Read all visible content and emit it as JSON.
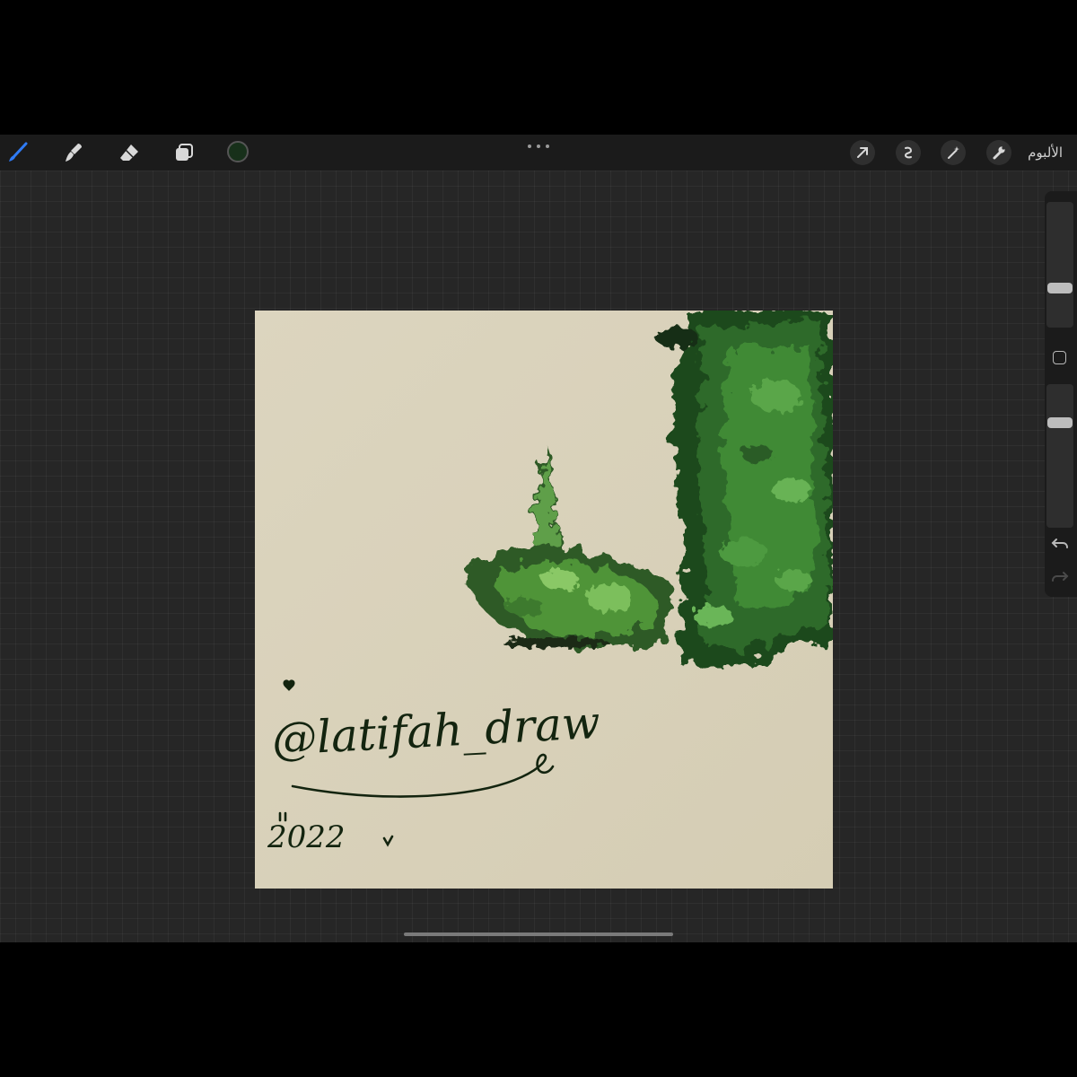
{
  "toolbar": {
    "gallery_label": "الألبوم",
    "current_color": "#17301a",
    "accent_color": "#2f7bf5",
    "left_icons": [
      "brush-icon",
      "smudge-icon",
      "eraser-icon",
      "layers-icon"
    ],
    "right_icons": [
      "actions-wrench-icon",
      "adjustments-wand-icon",
      "selection-icon",
      "transform-arrow-icon"
    ]
  },
  "artwork": {
    "signature": "@latifah_draw",
    "year": "2022",
    "paper_color": "#d9d2bb",
    "ink_color": "#13240f"
  },
  "sidebar": {
    "brush_size": 0.3,
    "brush_opacity": 0.75
  }
}
